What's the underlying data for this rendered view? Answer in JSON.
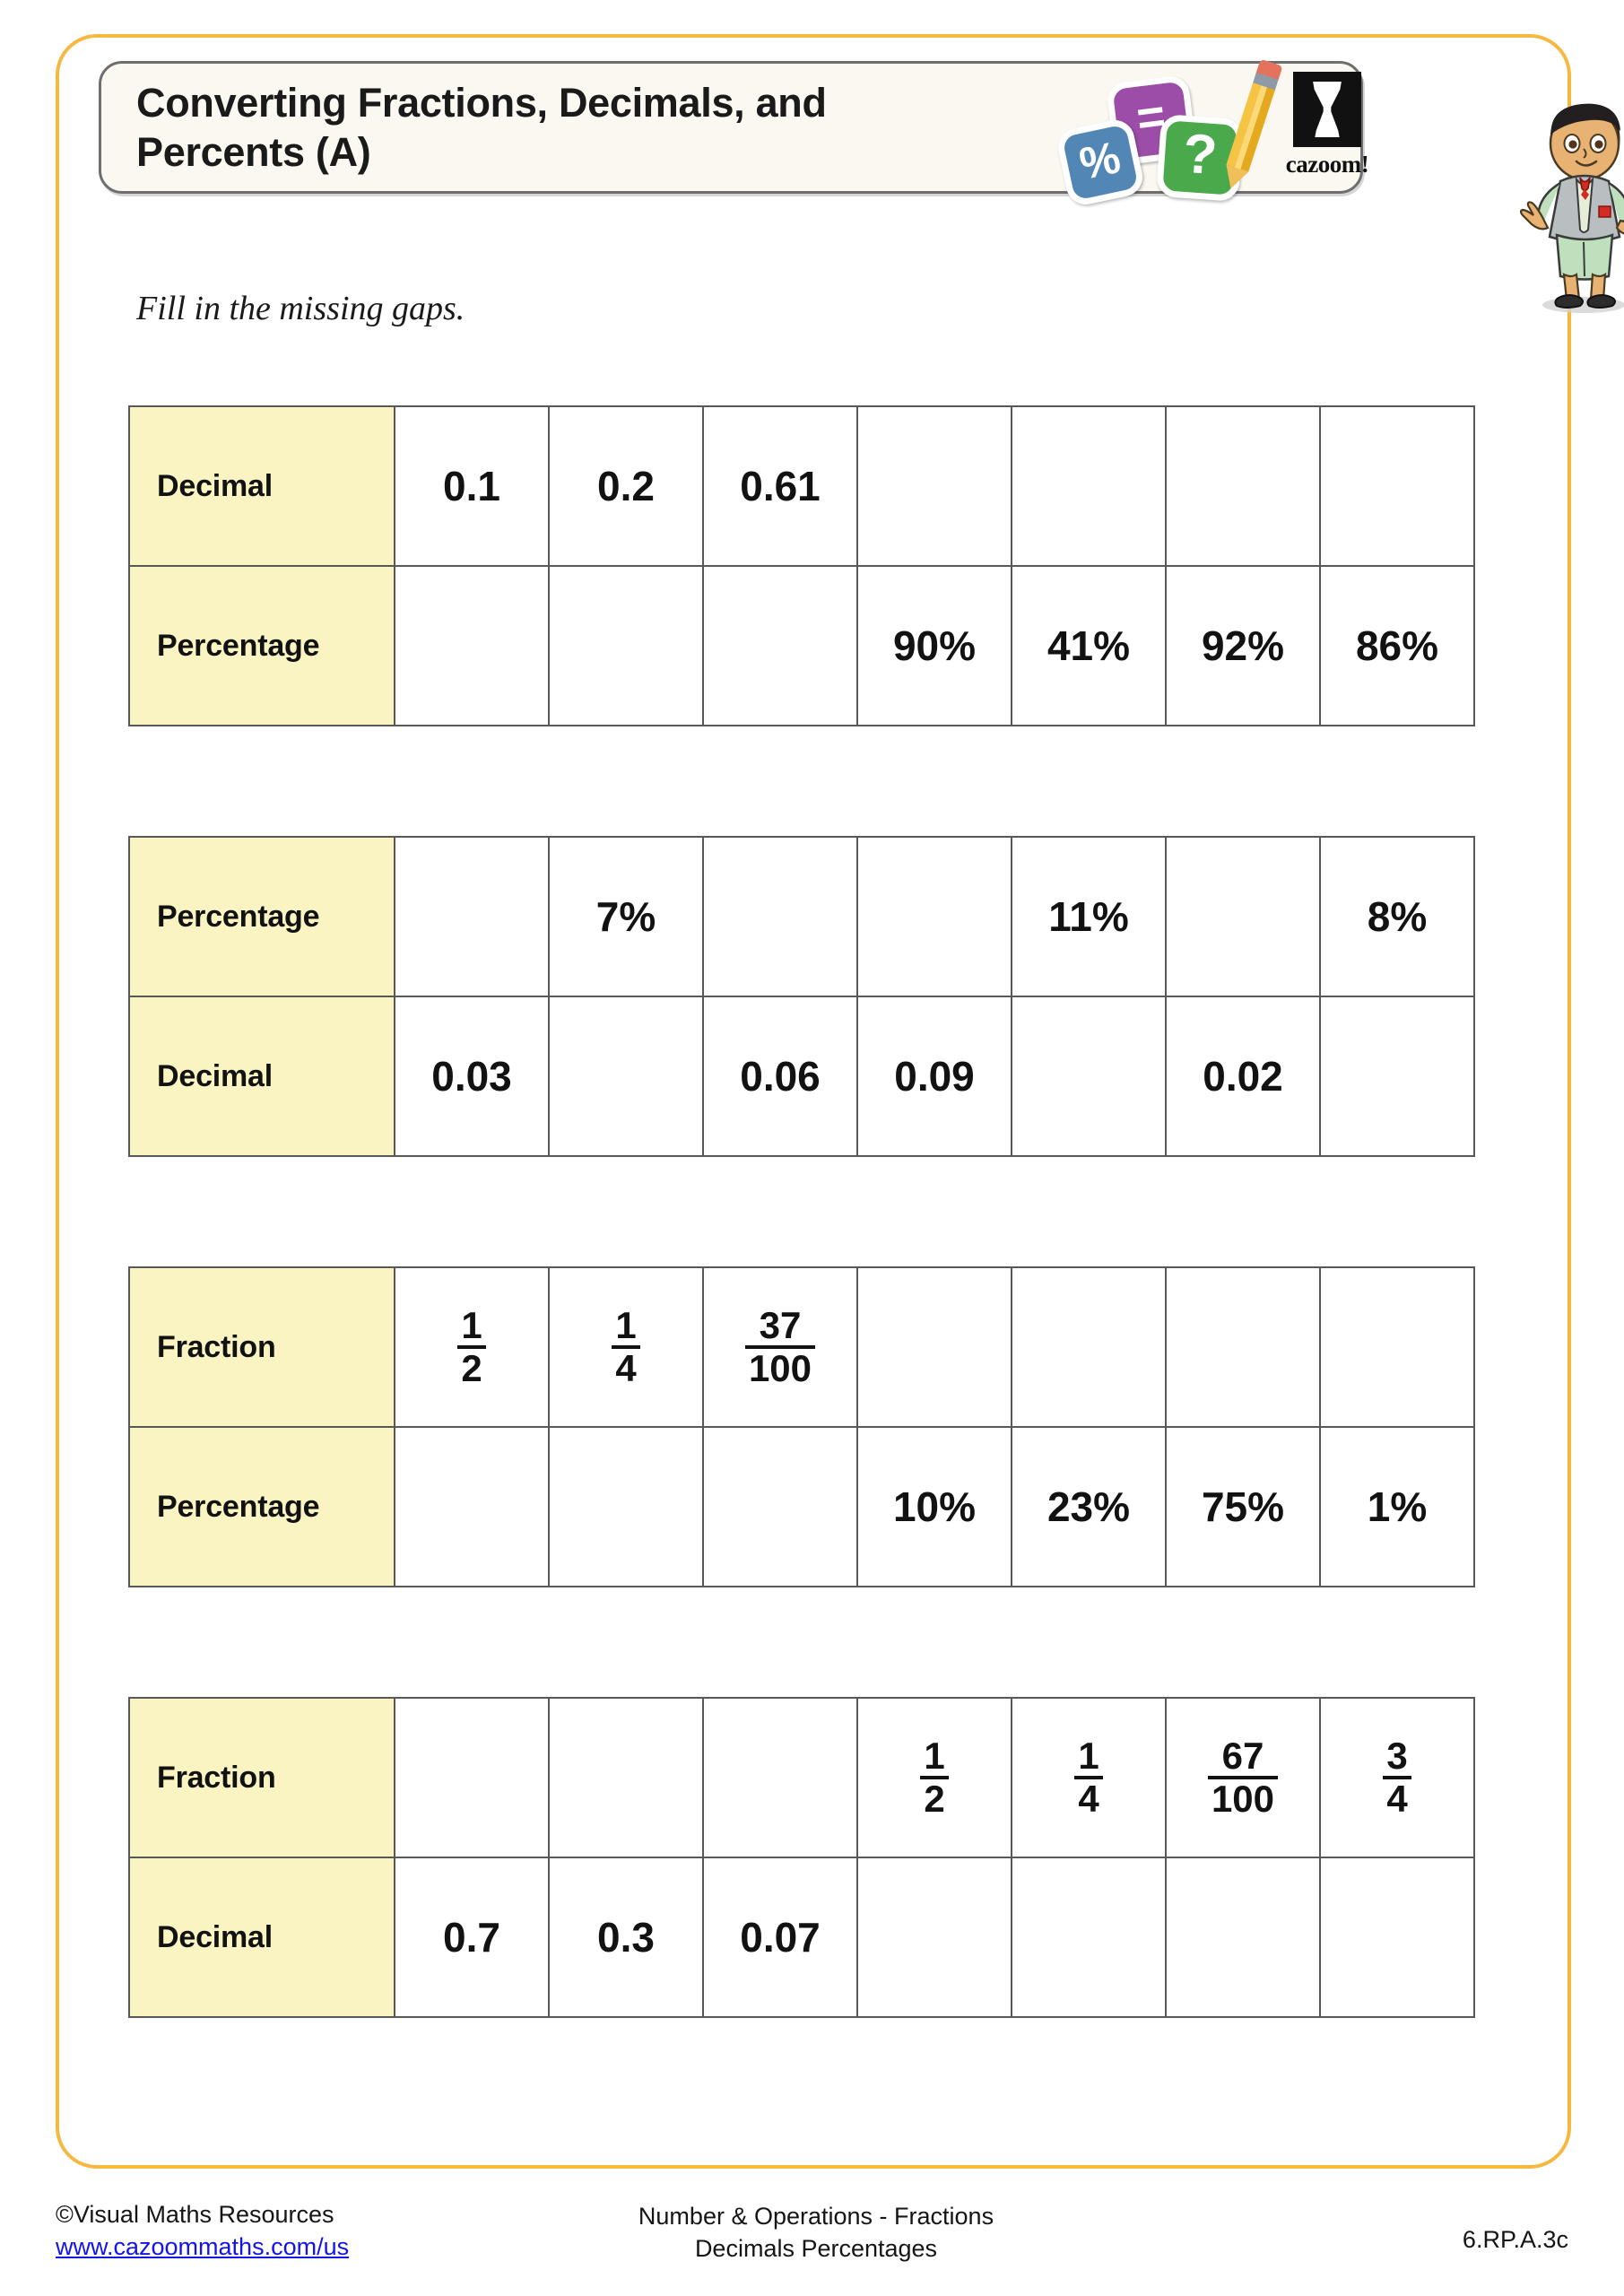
{
  "header": {
    "title": "Converting Fractions, Decimals, and Percents (A)",
    "logo": {
      "tile_percent": "%",
      "tile_equals": "=",
      "tile_question": "?",
      "brand_word": "cazoom!"
    }
  },
  "instruction": "Fill in the missing gaps.",
  "tables": [
    {
      "rows": [
        {
          "label": "Decimal",
          "cells": [
            "0.1",
            "0.2",
            "0.61",
            "",
            "",
            "",
            ""
          ]
        },
        {
          "label": "Percentage",
          "cells": [
            "",
            "",
            "",
            "90%",
            "41%",
            "92%",
            "86%"
          ]
        }
      ]
    },
    {
      "rows": [
        {
          "label": "Percentage",
          "cells": [
            "",
            "7%",
            "",
            "",
            "11%",
            "",
            "8%"
          ]
        },
        {
          "label": "Decimal",
          "cells": [
            "0.03",
            "",
            "0.06",
            "0.09",
            "",
            "0.02",
            ""
          ]
        }
      ]
    },
    {
      "rows": [
        {
          "label": "Fraction",
          "cells": [
            "1/2",
            "1/4",
            "37/100",
            "",
            "",
            "",
            ""
          ]
        },
        {
          "label": "Percentage",
          "cells": [
            "",
            "",
            "",
            "10%",
            "23%",
            "75%",
            "1%"
          ]
        }
      ]
    },
    {
      "rows": [
        {
          "label": "Fraction",
          "cells": [
            "",
            "",
            "",
            "1/2",
            "1/4",
            "67/100",
            "3/4"
          ]
        },
        {
          "label": "Decimal",
          "cells": [
            "0.7",
            "0.3",
            "0.07",
            "",
            "",
            "",
            ""
          ]
        }
      ]
    }
  ],
  "footer": {
    "copyright": "©Visual Maths Resources",
    "website": "www.cazoommaths.com/us",
    "topic_line1": "Number & Operations - Fractions",
    "topic_line2": "Decimals Percentages",
    "standard_code": "6.RP.A.3c"
  },
  "colors": {
    "page_border": "#F5B942",
    "label_cell": "#F9F4C2",
    "grid_line": "#585858",
    "link": "#1414E8"
  }
}
